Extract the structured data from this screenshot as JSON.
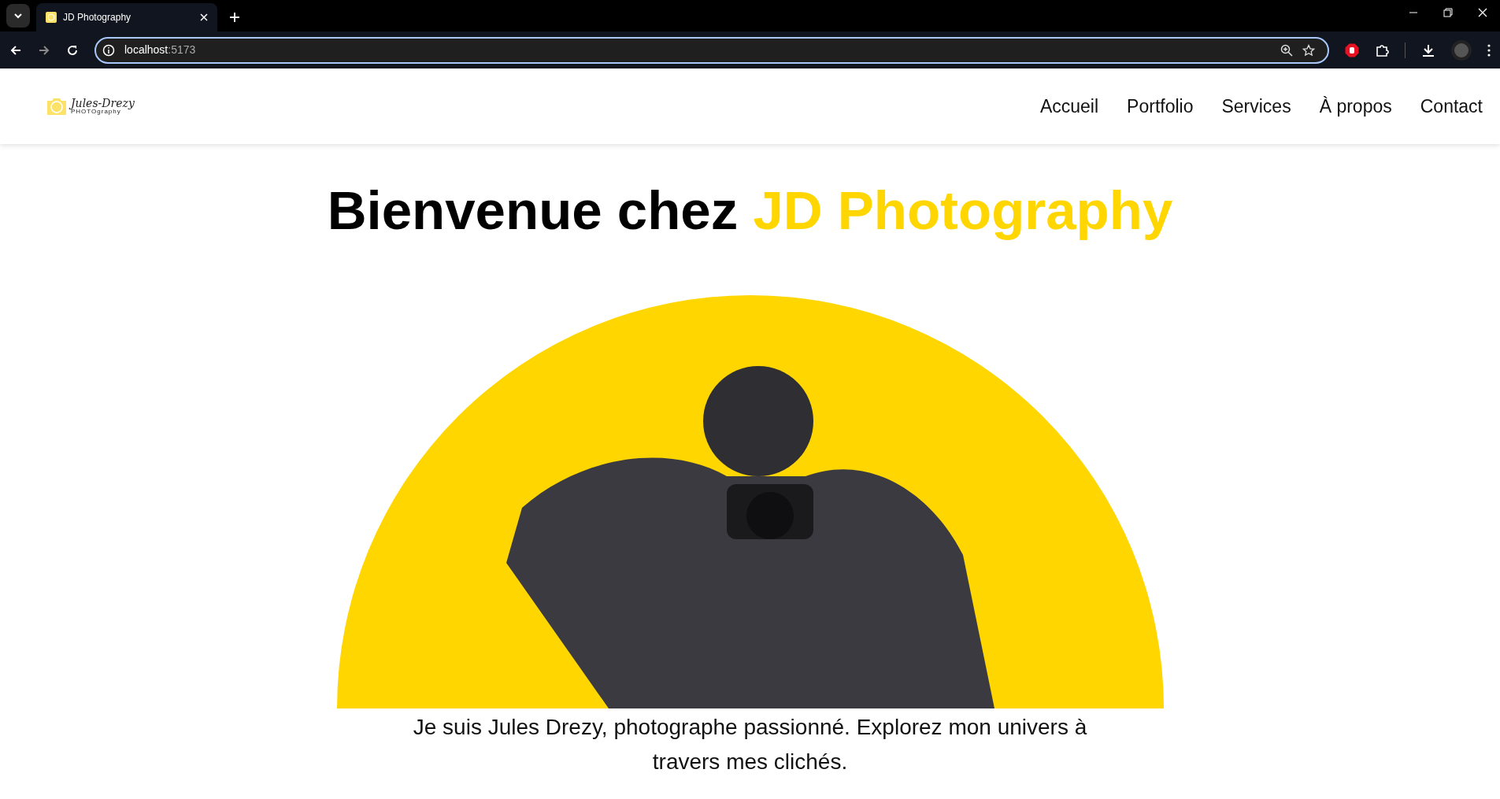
{
  "browser": {
    "tabs": [
      {
        "title": "JD Photography",
        "selected": true
      }
    ],
    "address": {
      "host": "localhost",
      "port": ":5173"
    }
  },
  "header": {
    "logo": {
      "name": "Jules-Drezy",
      "tagline": "PHOTOgraphy"
    },
    "nav": [
      {
        "label": "Accueil"
      },
      {
        "label": "Portfolio"
      },
      {
        "label": "Services"
      },
      {
        "label": "À propos"
      },
      {
        "label": "Contact"
      }
    ]
  },
  "hero": {
    "title": "Bienvenue chez",
    "title_highlight": "JD Photography",
    "intro": "Je suis Jules Drezy, photographe passionné. Explorez mon univers à travers mes clichés."
  }
}
